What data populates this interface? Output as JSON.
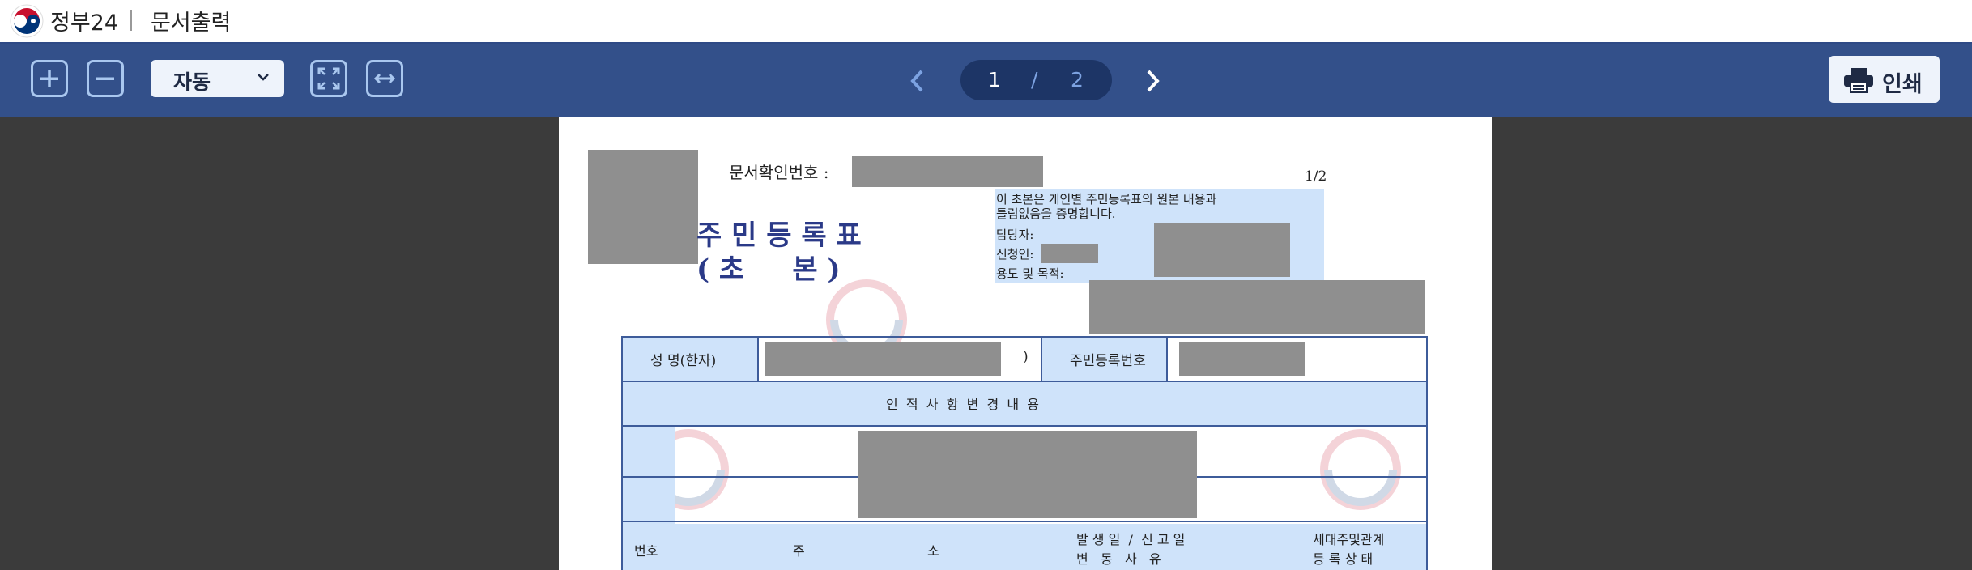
{
  "header": {
    "app_name": "정부24",
    "separator": "|",
    "title": "문서출력"
  },
  "toolbar": {
    "zoom_in_icon": "plus-square-icon",
    "zoom_out_icon": "minus-square-icon",
    "zoom_select": {
      "value": "자동"
    },
    "fit_page_icon": "fit-page-icon",
    "fit_width_icon": "fit-width-icon",
    "pager": {
      "current": "1",
      "separator": "/",
      "total": "2"
    },
    "print_label": "인쇄"
  },
  "document": {
    "confirm_number_label": "문서확인번호 :",
    "page_indicator": "1/2",
    "title_line1": "주 민 등 록 표",
    "title_line2": "( 초     본 )",
    "certify_text_line1": "이 초본은 개인별 주민등록표의 원본 내용과",
    "certify_text_line2": "틀림없음을 증명합니다.",
    "officer_label": "담당자:",
    "applicant_label": "신청인:",
    "purpose_label": "용도 및 목적:",
    "table": {
      "name_label": "성 명(한자)",
      "name_close_paren": ")",
      "rrn_label": "주민등록번호",
      "section_title": "인  적  사  항  변  경  내  용",
      "col_no": "번호",
      "col_address_1": "주",
      "col_address_2": "소",
      "col_date_line1": "발 생 일  /  신 고 일",
      "col_date_line2": "변   동   사   유",
      "col_household_line1": "세대주및관계",
      "col_household_line2": "등 록 상 태"
    }
  },
  "colors": {
    "toolbar_bg": "#33508a",
    "pager_bg": "#1d3566",
    "viewer_bg": "#3b3b3b",
    "highlight": "#cfe3fa",
    "table_border": "#3e5c9a"
  }
}
